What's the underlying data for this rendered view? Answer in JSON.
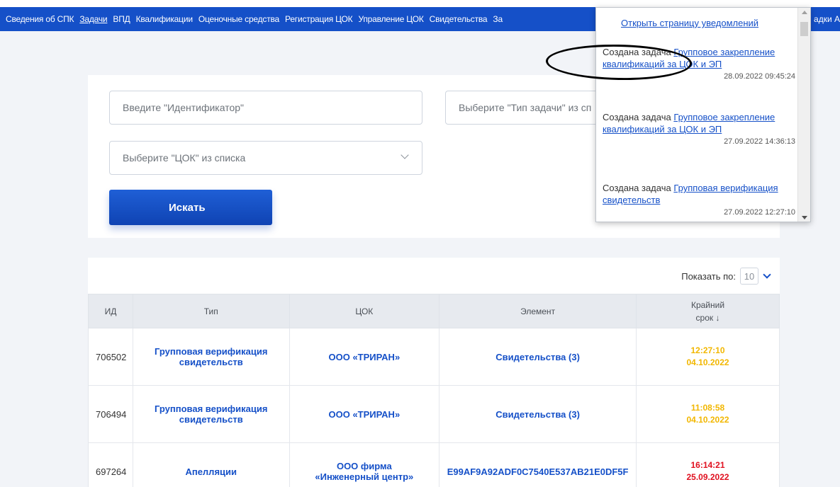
{
  "nav": {
    "items": [
      "Сведения об СПК",
      "Задачи",
      "ВПД",
      "Квалификации",
      "Оценочные средства",
      "Регистрация ЦОК",
      "Управление ЦОК",
      "Свидетельства",
      "За"
    ],
    "tail": "адки А"
  },
  "filters": {
    "identifier_placeholder": "Введите \"Идентификатор\"",
    "task_type_placeholder": "Выберите \"Тип задачи\" из сп",
    "cok_placeholder": "Выберите \"ЦОК\" из списка",
    "search_label": "Искать"
  },
  "pager": {
    "label": "Показать по:",
    "value": "10"
  },
  "table": {
    "headers": [
      "ИД",
      "Тип",
      "ЦОК",
      "Элемент",
      "Крайний срок ↓"
    ],
    "rows": [
      {
        "id": "706502",
        "type": "Групповая верификация свидетельств",
        "cok": "ООО «ТРИРАН»",
        "element": "Свидетельства (3)",
        "time": "12:27:10",
        "date": "04.10.2022"
      },
      {
        "id": "706494",
        "type": "Групповая верификация свидетельств",
        "cok": "ООО «ТРИРАН»",
        "element": "Свидетельства (3)",
        "time": "11:08:58",
        "date": "04.10.2022"
      },
      {
        "id": "697264",
        "type": "Апелляции",
        "cok": "ООО фирма «Инженерный центр»",
        "element": "E99AF9A92ADF0C7540E537AB21E0DF5F",
        "time": "16:14:21",
        "date": "25.09.2022"
      }
    ]
  },
  "notifications": {
    "open_link": "Открыть страницу уведомлений",
    "items": [
      {
        "prefix": "Создана задача",
        "link": "Групповое закрепление квалификаций за ЦОК и ЭП",
        "date": "28.09.2022 09:45:24"
      },
      {
        "prefix": "Создана задача",
        "link": "Групповое закрепление квалификаций за ЦОК и ЭП",
        "date": "27.09.2022 14:36:13"
      },
      {
        "prefix": "Создана задача",
        "link": "Групповая верификация свидетельств",
        "date": "27.09.2022 12:27:10"
      }
    ]
  },
  "colors": {
    "brand": "#1550c8",
    "deadline_warning": "#f2b700",
    "deadline_overdue": "#e0101f"
  }
}
